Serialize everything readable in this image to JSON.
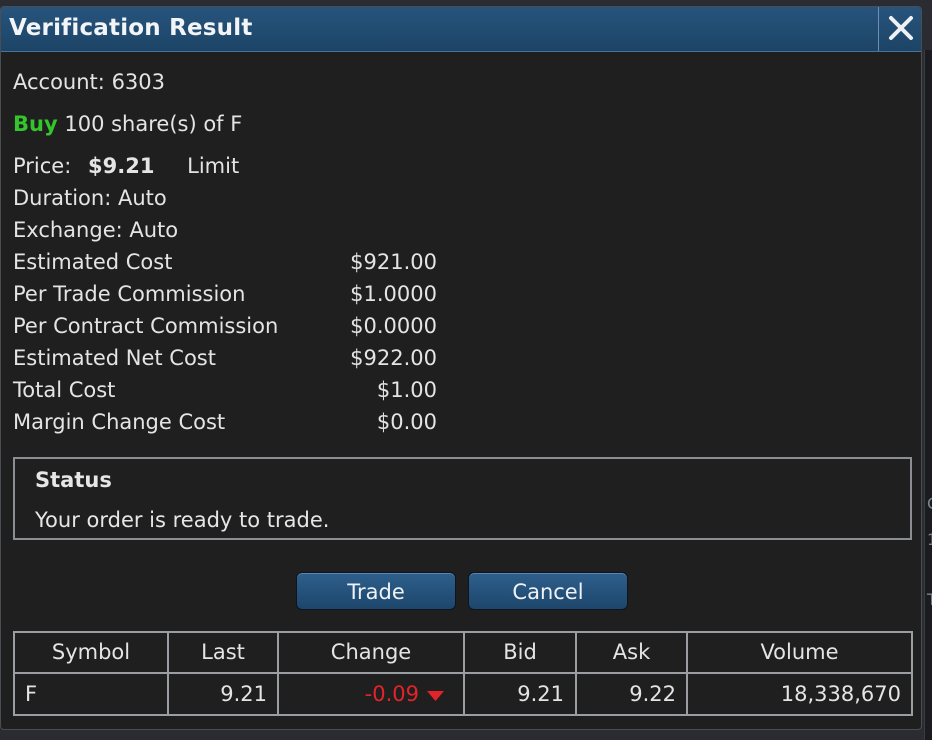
{
  "dialog": {
    "title": "Verification Result"
  },
  "order": {
    "account_label": "Account:",
    "account_number": "6303",
    "side": "Buy",
    "description": "100 share(s) of F",
    "price_label": "Price:",
    "price_value": "$9.21",
    "order_type": "Limit",
    "duration": "Duration: Auto",
    "exchange": "Exchange: Auto"
  },
  "costs": [
    {
      "label": "Estimated Cost",
      "value": "$921.00"
    },
    {
      "label": "Per Trade Commission",
      "value": "$1.0000"
    },
    {
      "label": "Per Contract Commission",
      "value": "$0.0000"
    },
    {
      "label": "Estimated Net Cost",
      "value": "$922.00"
    },
    {
      "label": "Total Cost",
      "value": "$1.00"
    },
    {
      "label": "Margin Change Cost",
      "value": "$0.00"
    }
  ],
  "status": {
    "title": "Status",
    "message": "Your order is ready to trade."
  },
  "buttons": {
    "trade": "Trade",
    "cancel": "Cancel"
  },
  "quote": {
    "headers": [
      "Symbol",
      "Last",
      "Change",
      "Bid",
      "Ask",
      "Volume"
    ],
    "row": {
      "symbol": "F",
      "last": "9.21",
      "change": "-0.09",
      "bid": "9.21",
      "ask": "9.22",
      "volume": "18,338,670"
    },
    "change_icon": "triangle-down-icon"
  },
  "colors": {
    "title_bar": "#1f4a70",
    "buy": "#34c42b",
    "negative": "#e2242a",
    "button": "#245178"
  },
  "background_fragments": [
    "C",
    "1",
    "T"
  ]
}
